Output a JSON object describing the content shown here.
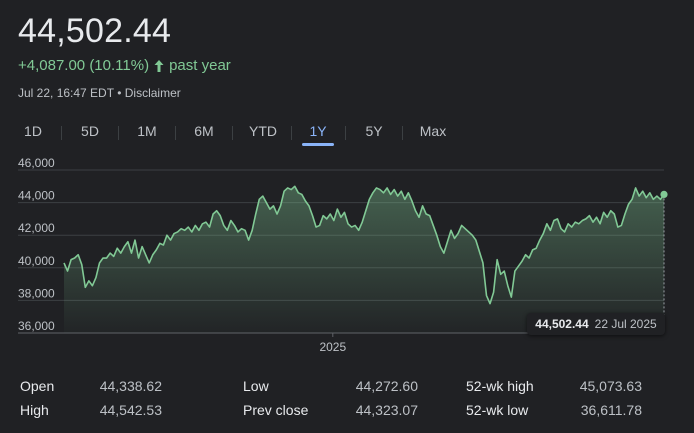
{
  "quote": {
    "price": "44,502.44",
    "change_text": "+4,087.00 (10.11%)",
    "change_period": "past year",
    "timestamp": "Jul 22, 16:47 EDT",
    "separator": "•",
    "disclaimer": "Disclaimer"
  },
  "colors": {
    "background": "#202124",
    "positive": "#81c995",
    "accent": "#8ab4f8",
    "line": "#81c995"
  },
  "tabs": [
    {
      "label": "1D",
      "active": false
    },
    {
      "label": "5D",
      "active": false
    },
    {
      "label": "1M",
      "active": false
    },
    {
      "label": "6M",
      "active": false
    },
    {
      "label": "YTD",
      "active": false
    },
    {
      "label": "1Y",
      "active": true
    },
    {
      "label": "5Y",
      "active": false
    },
    {
      "label": "Max",
      "active": false
    }
  ],
  "chart_data": {
    "type": "area",
    "y_ticks": [
      "46,000",
      "44,000",
      "42,000",
      "40,000",
      "38,000",
      "36,000"
    ],
    "ylim": [
      36000,
      46000
    ],
    "x_ticks": [
      {
        "label": "2025",
        "fraction": 0.448
      }
    ],
    "series": [
      {
        "values": [
          40300,
          39800,
          40500,
          40600,
          40800,
          40200,
          38800,
          39200,
          38900,
          39400,
          40300,
          40600,
          40600,
          40900,
          40700,
          41200,
          40900,
          41300,
          41600,
          40900,
          41700,
          40600,
          41300,
          40800,
          40300,
          40800,
          41100,
          41500,
          41400,
          42000,
          41700,
          42100,
          42200,
          42400,
          42300,
          42500,
          42200,
          42600,
          42300,
          42700,
          42800,
          42500,
          43300,
          43500,
          43200,
          42600,
          42300,
          42900,
          42600,
          42200,
          42400,
          42300,
          41700,
          42300,
          43300,
          44200,
          44400,
          44000,
          43600,
          43800,
          43300,
          43800,
          44700,
          44900,
          44800,
          45000,
          44600,
          44500,
          44100,
          43800,
          43200,
          42500,
          42600,
          43200,
          43000,
          43300,
          42900,
          43600,
          43100,
          43400,
          42700,
          42500,
          42600,
          42300,
          42800,
          43500,
          44200,
          44600,
          44900,
          44800,
          44600,
          44900,
          44500,
          44800,
          44400,
          44700,
          44200,
          44600,
          44100,
          43500,
          43100,
          43800,
          43300,
          43200,
          42600,
          42000,
          41300,
          40900,
          41600,
          42300,
          41800,
          42100,
          42600,
          42400,
          42200,
          42000,
          41700,
          41000,
          40300,
          38300,
          37800,
          38500,
          40500,
          39600,
          39800,
          38900,
          38200,
          39800,
          40100,
          40400,
          40800,
          40600,
          41100,
          41200,
          41700,
          42100,
          42700,
          42300,
          42900,
          43000,
          42400,
          42200,
          42700,
          42500,
          42800,
          42700,
          42900,
          43000,
          43200,
          42800,
          43100,
          42700,
          43400,
          43100,
          43500,
          43300,
          42500,
          42600,
          43300,
          43900,
          44200,
          44900,
          44400,
          44700,
          44300,
          44600,
          44200,
          44400,
          44200,
          44502.44
        ]
      }
    ],
    "tooltip": {
      "value": "44,502.44",
      "date": "22 Jul 2025"
    }
  },
  "stats": {
    "rows": [
      [
        {
          "label": "Open",
          "value": "44,338.62"
        },
        {
          "label": "Low",
          "value": "44,272.60"
        },
        {
          "label": "52-wk high",
          "value": "45,073.63"
        }
      ],
      [
        {
          "label": "High",
          "value": "44,542.53"
        },
        {
          "label": "Prev close",
          "value": "44,323.07"
        },
        {
          "label": "52-wk low",
          "value": "36,611.78"
        }
      ]
    ]
  }
}
